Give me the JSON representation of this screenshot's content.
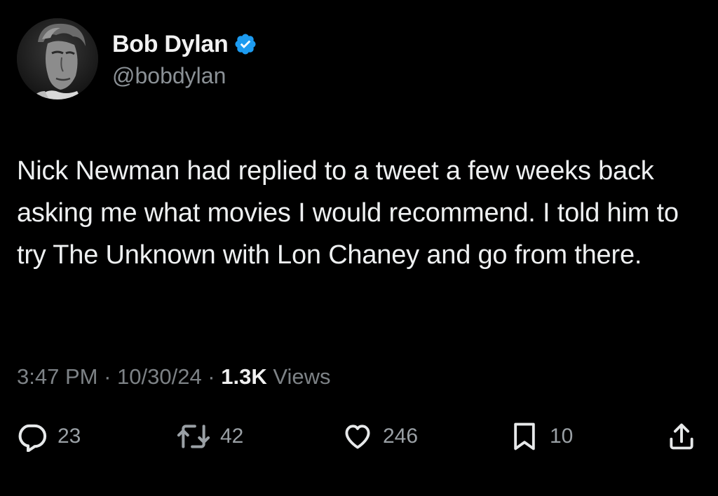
{
  "author": {
    "display_name": "Bob Dylan",
    "handle": "@bobdylan",
    "verified": true,
    "verified_color": "#1d9bf0"
  },
  "tweet": {
    "text": "Nick Newman had replied to a tweet a few weeks back asking me what movies I would recommend. I told him to try The Unknown with Lon Chaney and go from there.",
    "time": "3:47 PM",
    "separator": " · ",
    "date": "10/30/24",
    "views_count": "1.3K",
    "views_label": " Views"
  },
  "actions": {
    "reply": {
      "icon": "reply-icon",
      "count": "23"
    },
    "retweet": {
      "icon": "retweet-icon",
      "count": "42"
    },
    "like": {
      "icon": "heart-icon",
      "count": "246"
    },
    "bookmark": {
      "icon": "bookmark-icon",
      "count": "10"
    },
    "share": {
      "icon": "share-icon"
    }
  },
  "colors": {
    "background": "#000000",
    "text_primary": "#eef0f1",
    "text_secondary": "#7d8286",
    "icon": "#9aa0a5"
  }
}
